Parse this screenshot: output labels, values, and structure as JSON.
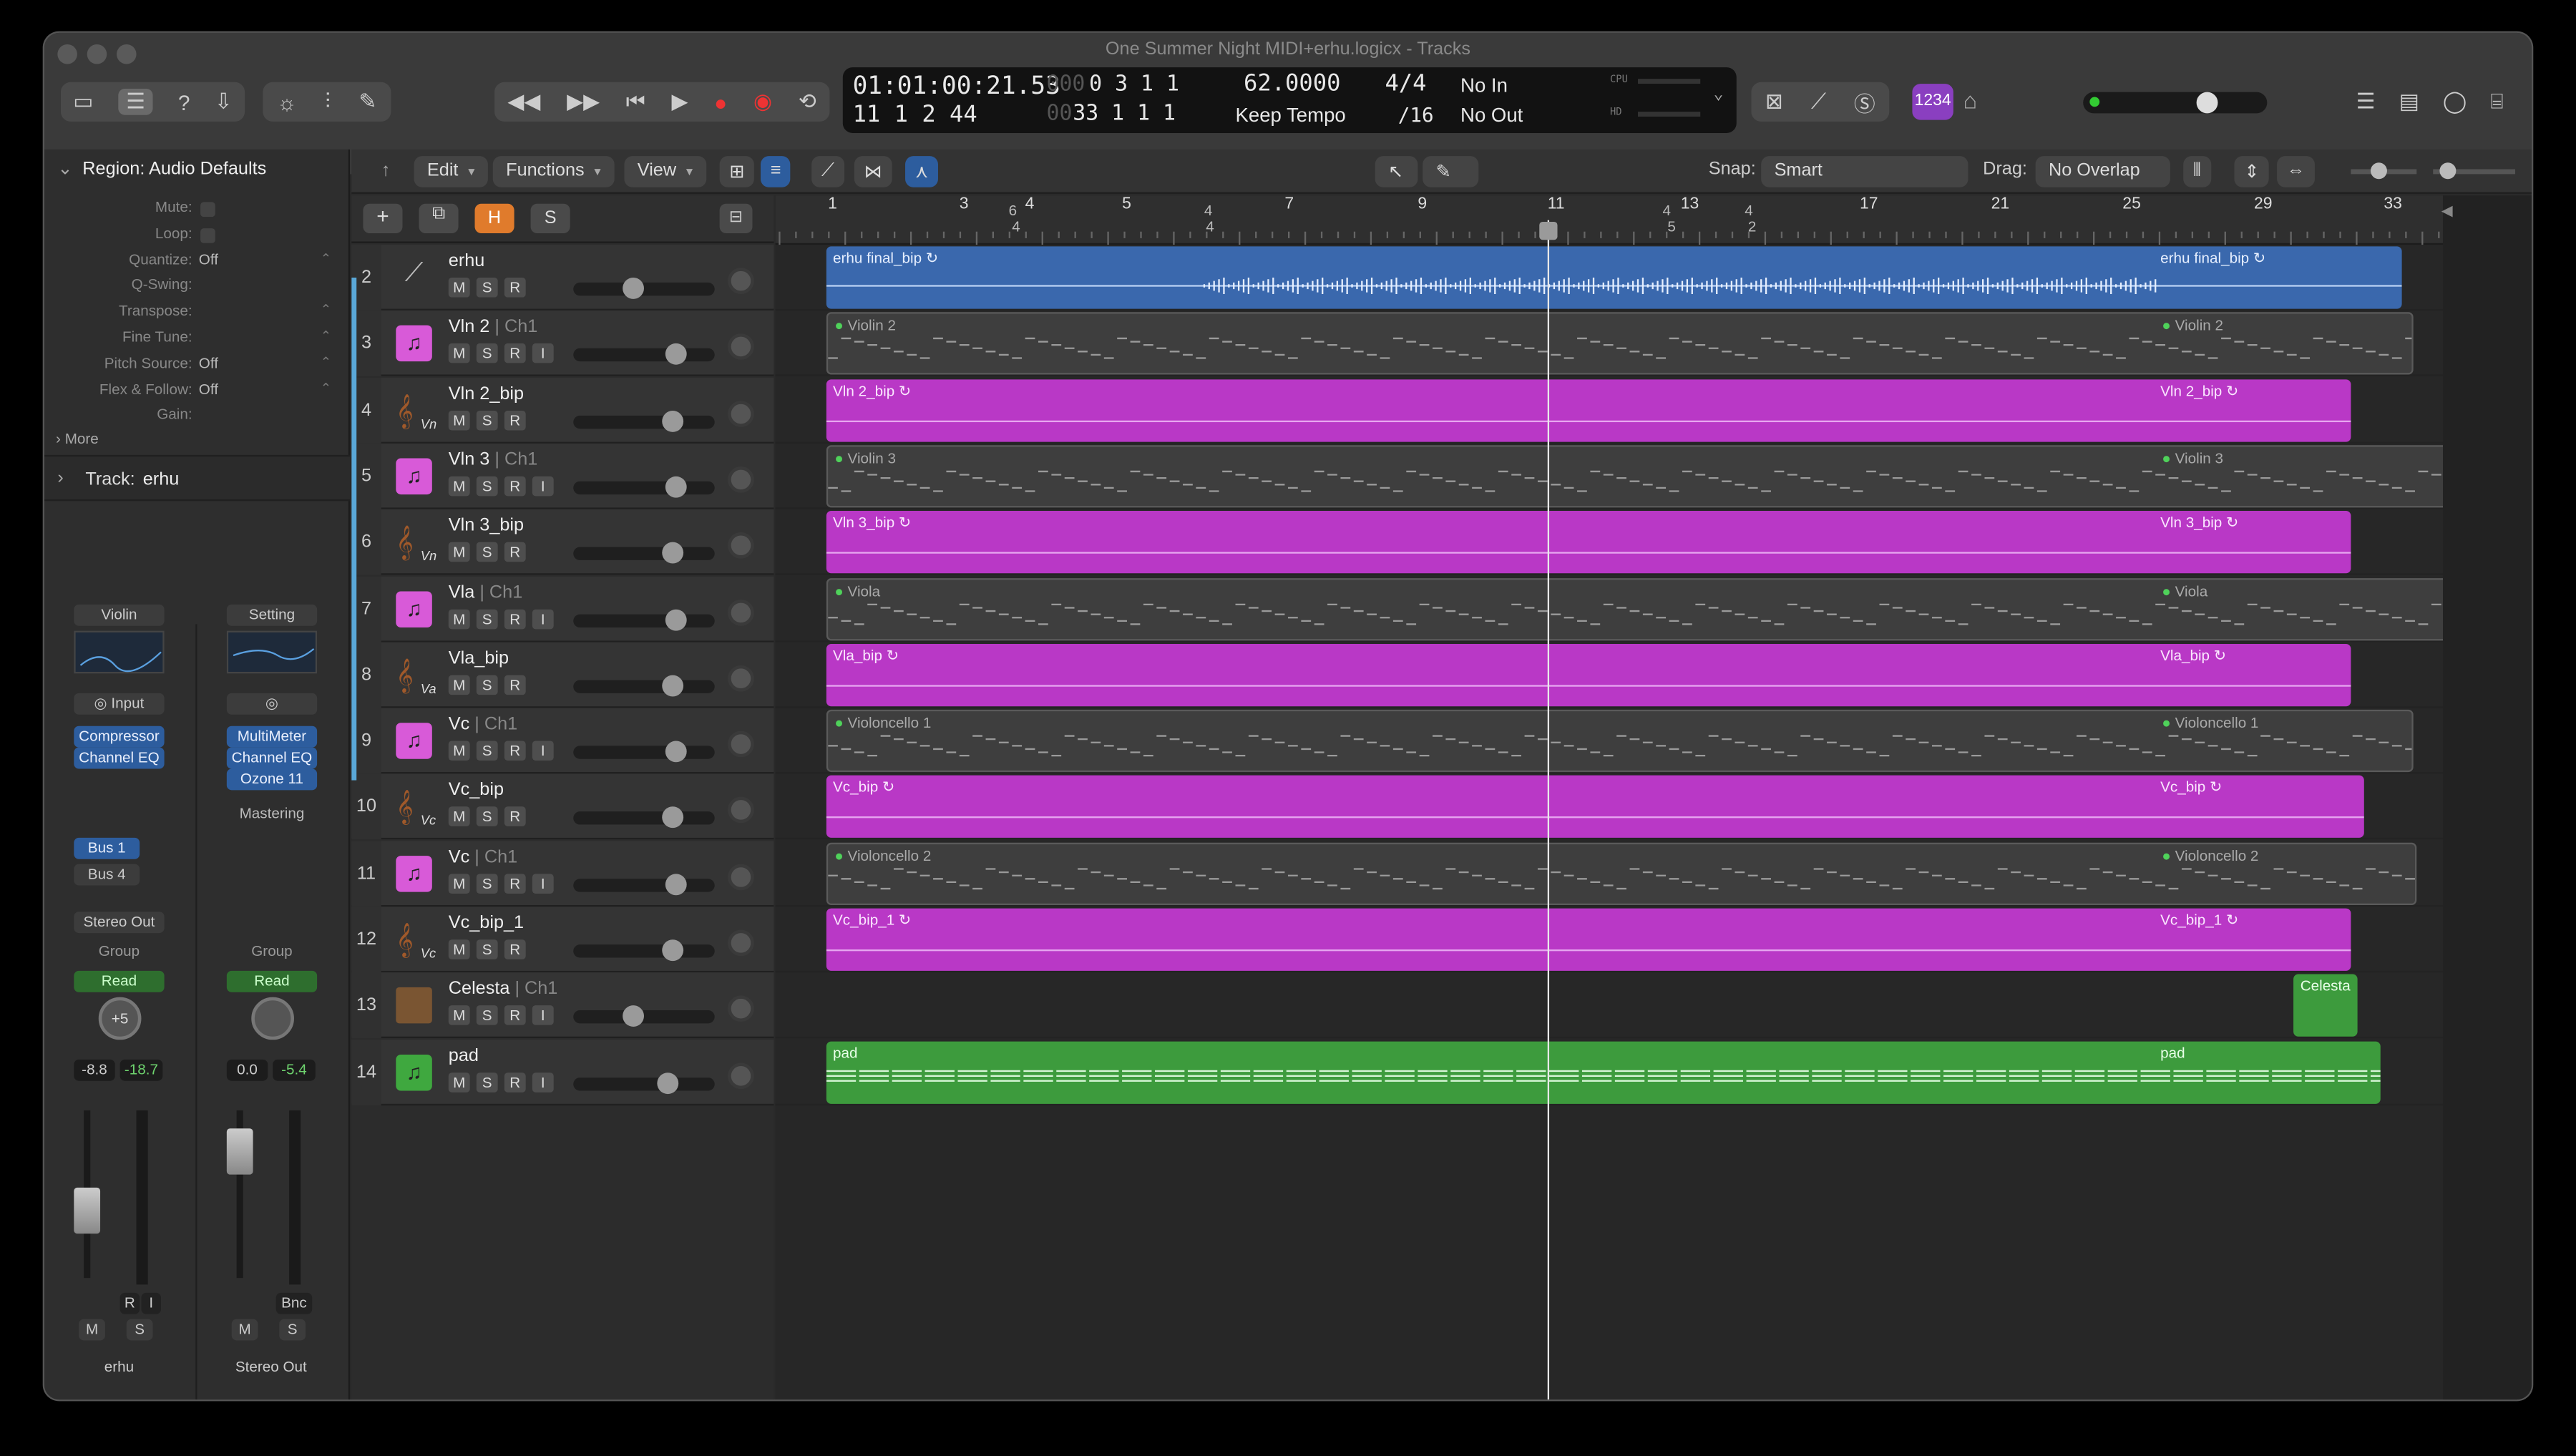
{
  "window": {
    "title": "One Summer Night MIDI+erhu.logicx - Tracks"
  },
  "lcd": {
    "time": "01:01:00:21.53",
    "time_sub": "11  1  2  44",
    "pos_bar": "0  3  1  1",
    "pos_bar_dim": "000",
    "pos_sub": "33  1  1  1",
    "pos_sub_dim": "00",
    "tempo": "62.0000",
    "tempo_mode": "Keep Tempo",
    "sig": "4/4",
    "div": "/16",
    "in": "No In",
    "out": "No Out",
    "cpu": "CPU",
    "hd": "HD"
  },
  "toolbar": {
    "count_in_badge": "1234"
  },
  "controlbar": {
    "edit": "Edit",
    "functions": "Functions",
    "view": "View",
    "snap_label": "Snap:",
    "snap_value": "Smart",
    "drag_label": "Drag:",
    "drag_value": "No Overlap"
  },
  "inspector": {
    "region_title": "Region: Audio Defaults",
    "params": [
      {
        "k": "Mute:",
        "v": ""
      },
      {
        "k": "Loop:",
        "v": ""
      },
      {
        "k": "Quantize:",
        "v": "Off"
      },
      {
        "k": "Q-Swing:",
        "v": ""
      },
      {
        "k": "Transpose:",
        "v": ""
      },
      {
        "k": "Fine Tune:",
        "v": ""
      },
      {
        "k": "Pitch Source:",
        "v": "Off"
      },
      {
        "k": "Flex & Follow:",
        "v": "Off"
      },
      {
        "k": "Gain:",
        "v": ""
      }
    ],
    "more": "More",
    "track_label": "Track:",
    "track_name": "erhu",
    "strip1": {
      "setting": "Violin",
      "input": "Input",
      "plugins": [
        "Compressor",
        "Channel EQ"
      ],
      "sends": [
        "Bus 1",
        "Bus 4"
      ],
      "output": "Stereo Out",
      "group": "Group",
      "auto": "Read",
      "pan": "+5",
      "vol": "-8.8",
      "peak": "-18.7",
      "r": "R",
      "i": "I",
      "m": "M",
      "s": "S",
      "name": "erhu"
    },
    "strip2": {
      "setting": "Setting",
      "plugins": [
        "MultiMeter",
        "Channel EQ",
        "Ozone 11"
      ],
      "mastering": "Mastering",
      "group": "Group",
      "auto": "Read",
      "vol": "0.0",
      "peak": "-5.4",
      "bnc": "Bnc",
      "m": "M",
      "s": "S",
      "name": "Stereo Out"
    }
  },
  "track_hdr": {
    "h": "H",
    "s": "S"
  },
  "ruler": {
    "bars": [
      "1",
      "3",
      "4",
      "5",
      "7",
      "9",
      "11",
      "13",
      "17",
      "21",
      "25",
      "29",
      "33"
    ],
    "sig": [
      "6",
      "4",
      "4",
      "4",
      "4",
      "5",
      "4",
      "2",
      "4"
    ]
  },
  "tracks": [
    {
      "num": "2",
      "name": "erhu",
      "ch": "",
      "kind": "audio",
      "btns": [
        "M",
        "S",
        "R"
      ],
      "vol": 0.42
    },
    {
      "num": "3",
      "name": "Vln 2",
      "ch": "| Ch1",
      "kind": "inst",
      "btns": [
        "M",
        "S",
        "R",
        "I"
      ],
      "vol": 0.72
    },
    {
      "num": "4",
      "name": "Vln 2_bip",
      "ch": "",
      "kind": "violin",
      "sub": "Vn",
      "btns": [
        "M",
        "S",
        "R"
      ],
      "vol": 0.7
    },
    {
      "num": "5",
      "name": "Vln 3",
      "ch": "| Ch1",
      "kind": "inst",
      "btns": [
        "M",
        "S",
        "R",
        "I"
      ],
      "vol": 0.72
    },
    {
      "num": "6",
      "name": "Vln 3_bip",
      "ch": "",
      "kind": "violin",
      "sub": "Vn",
      "btns": [
        "M",
        "S",
        "R"
      ],
      "vol": 0.7
    },
    {
      "num": "7",
      "name": "Vla",
      "ch": "| Ch1",
      "kind": "inst",
      "btns": [
        "M",
        "S",
        "R",
        "I"
      ],
      "vol": 0.72
    },
    {
      "num": "8",
      "name": "Vla_bip",
      "ch": "",
      "kind": "violin",
      "sub": "Va",
      "btns": [
        "M",
        "S",
        "R"
      ],
      "vol": 0.7
    },
    {
      "num": "9",
      "name": "Vc",
      "ch": "| Ch1",
      "kind": "inst",
      "btns": [
        "M",
        "S",
        "R",
        "I"
      ],
      "vol": 0.72
    },
    {
      "num": "10",
      "name": "Vc_bip",
      "ch": "",
      "kind": "cello",
      "sub": "Vc",
      "btns": [
        "M",
        "S",
        "R"
      ],
      "vol": 0.7
    },
    {
      "num": "11",
      "name": "Vc",
      "ch": "| Ch1",
      "kind": "inst",
      "btns": [
        "M",
        "S",
        "R",
        "I"
      ],
      "vol": 0.72
    },
    {
      "num": "12",
      "name": "Vc_bip_1",
      "ch": "",
      "kind": "cello",
      "sub": "Vc",
      "btns": [
        "M",
        "S",
        "R"
      ],
      "vol": 0.7
    },
    {
      "num": "13",
      "name": "Celesta",
      "ch": "| Ch1",
      "kind": "celesta",
      "btns": [
        "M",
        "S",
        "R",
        "I"
      ],
      "vol": 0.42
    },
    {
      "num": "14",
      "name": "pad",
      "ch": "",
      "kind": "pad",
      "btns": [
        "M",
        "S",
        "R",
        "I"
      ],
      "vol": 0.66
    }
  ],
  "regions": [
    {
      "name": "erhu final_bip",
      "type": "aud",
      "x0": 0.0,
      "x1": 0.945,
      "row": 0
    },
    {
      "name": "Violin 2",
      "type": "midi",
      "x0": 0.0,
      "x1": 0.952,
      "row": 1
    },
    {
      "name": "Vln 2_bip",
      "type": "bip",
      "x0": 0.0,
      "x1": 0.914,
      "row": 2
    },
    {
      "name": "Violin 3",
      "type": "midi",
      "x0": 0.0,
      "x1": 0.992,
      "row": 3
    },
    {
      "name": "Vln 3_bip",
      "type": "bip",
      "x0": 0.0,
      "x1": 0.914,
      "row": 4
    },
    {
      "name": "Viola",
      "type": "midi",
      "x0": 0.0,
      "x1": 0.972,
      "row": 5
    },
    {
      "name": "Vla_bip",
      "type": "bip",
      "x0": 0.0,
      "x1": 0.914,
      "row": 6
    },
    {
      "name": "Violoncello 1",
      "type": "midi",
      "x0": 0.0,
      "x1": 0.952,
      "row": 7
    },
    {
      "name": "Vc_bip",
      "type": "bip",
      "x0": 0.0,
      "x1": 0.922,
      "row": 8
    },
    {
      "name": "Violoncello 2",
      "type": "midi",
      "x0": 0.0,
      "x1": 0.954,
      "row": 9
    },
    {
      "name": "Vc_bip_1",
      "type": "bip",
      "x0": 0.0,
      "x1": 0.914,
      "row": 10
    },
    {
      "name": "Celesta",
      "type": "grn",
      "x0": 0.88,
      "x1": 0.918,
      "row": 11,
      "single": true
    },
    {
      "name": "pad",
      "type": "grn",
      "x0": 0.0,
      "x1": 0.932,
      "row": 12
    }
  ],
  "colors": {
    "bip": "#b938c6",
    "audio": "#3a68ad",
    "green": "#3d9b3d",
    "inst_icon": "#d85ad8",
    "pad_icon": "#3fa83f"
  }
}
